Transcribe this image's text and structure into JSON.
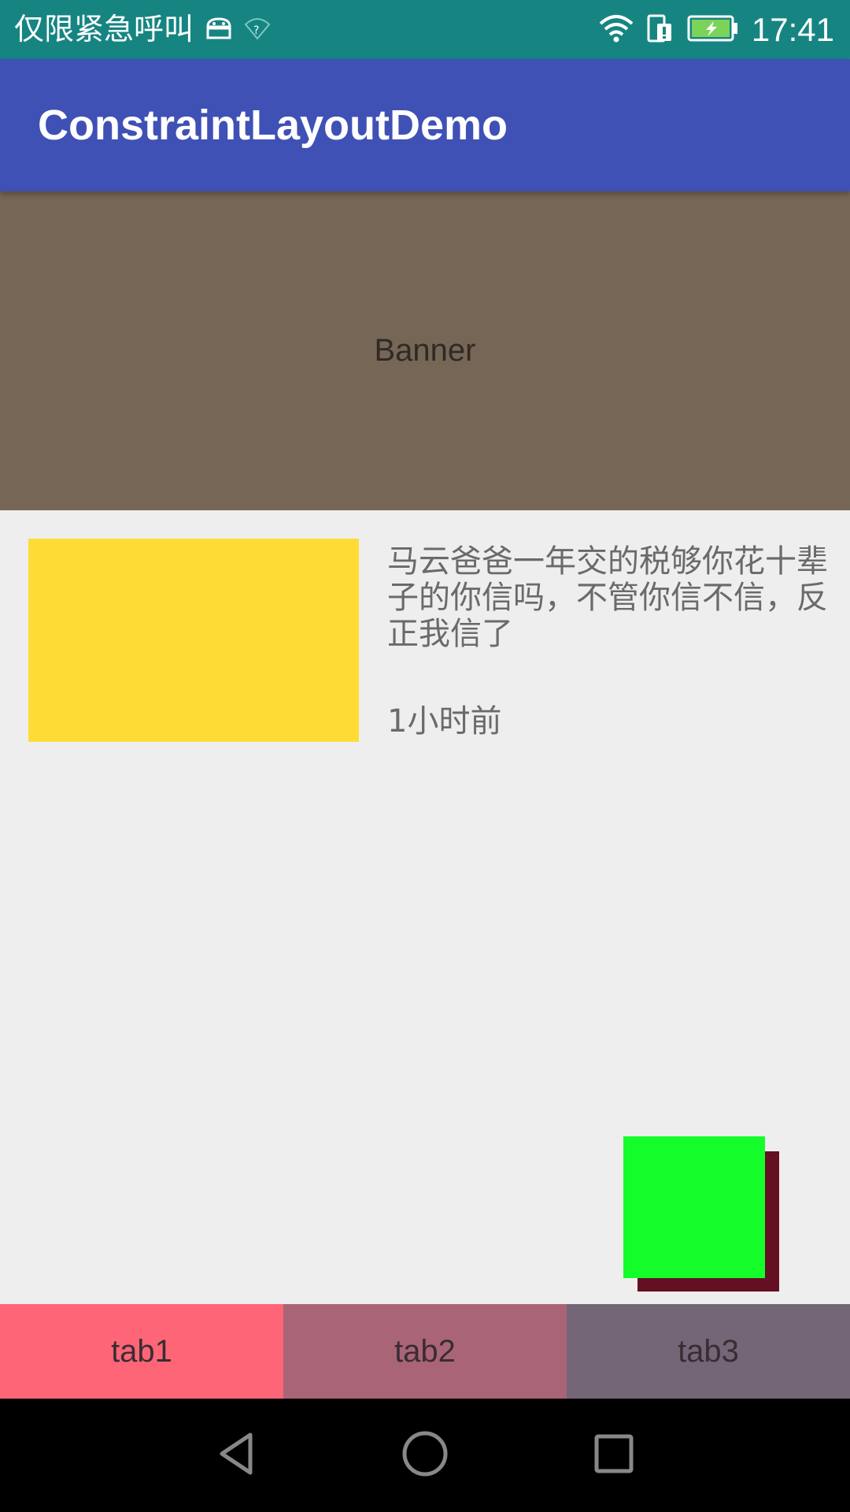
{
  "status_bar": {
    "carrier_text": "仅限紧急呼叫",
    "time": "17:41",
    "icons": [
      "android-debug-icon",
      "wifi-unknown-icon",
      "wifi-icon",
      "sim-alert-icon",
      "battery-charging-icon"
    ],
    "background_color": "#168582"
  },
  "app_bar": {
    "title": "ConstraintLayoutDemo",
    "background_color": "#3f51b5"
  },
  "banner": {
    "label": "Banner",
    "background_color": "#766656"
  },
  "news_item": {
    "title": "马云爸爸一年交的税够你花十辈子的你信吗，不管你信不信，反正我信了",
    "time": "1小时前",
    "thumbnail_color": "#fedc35"
  },
  "floating_square": {
    "color": "#14fd2a",
    "shadow_color": "#640f22"
  },
  "tabs": [
    {
      "label": "tab1",
      "color": "#fe6677"
    },
    {
      "label": "tab2",
      "color": "#a96575"
    },
    {
      "label": "tab3",
      "color": "#756677"
    }
  ],
  "nav_bar": {
    "buttons": [
      "back-icon",
      "home-icon",
      "recents-icon"
    ]
  }
}
